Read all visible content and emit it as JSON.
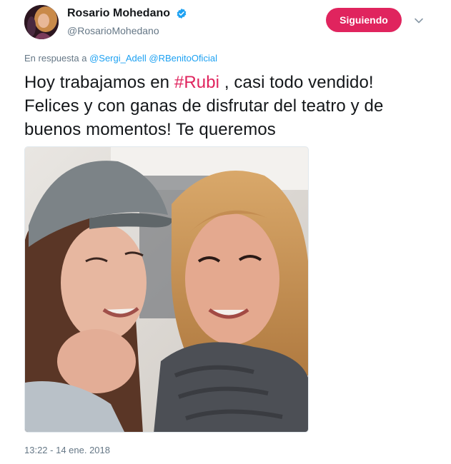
{
  "author": {
    "display_name": "Rosario Mohedano",
    "handle": "@RosarioMohedano",
    "verified": true,
    "avatar_icon": "profile-photo"
  },
  "follow_button": {
    "label": "Siguiendo"
  },
  "more_menu": {
    "icon": "chevron-down-icon"
  },
  "reply": {
    "prefix": "En respuesta a",
    "mentions": [
      "@Sergi_Adell",
      "@RBenitoOficial"
    ]
  },
  "tweet": {
    "text_before": "Hoy trabajamos en ",
    "hashtag": "#Rubi",
    "text_after": " , casi todo vendido! Felices y con ganas de disfrutar del teatro y de buenos momentos! Te queremos"
  },
  "media": {
    "type": "photo",
    "alt": ""
  },
  "timestamp": "13:22 - 14 ene. 2018",
  "colors": {
    "accent": "#e0245e",
    "link": "#1da1f2",
    "secondary_text": "#657786",
    "primary_text": "#14171a",
    "verified_badge": "#1da1f2"
  }
}
